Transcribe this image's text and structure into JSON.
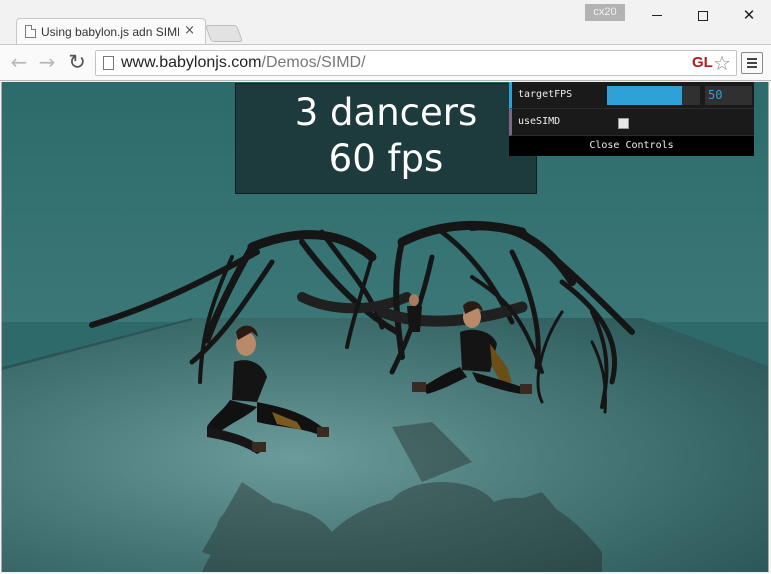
{
  "browser": {
    "tab_title": "Using babylon.js adn SIMD",
    "tab_close": "×",
    "badge": "cx20",
    "window_close": "✕",
    "nav_back": "←",
    "nav_forward": "→",
    "nav_reload": "↻",
    "url_domain": "www.babylonjs.com",
    "url_path": "/Demos/SIMD/",
    "gl_label": "GL",
    "star": "☆"
  },
  "overlay": {
    "dancers_text": "3 dancers",
    "fps_text": "60 fps"
  },
  "controls": {
    "target_fps_label": "targetFPS",
    "target_fps_value": "50",
    "target_fps_fraction": 0.81,
    "use_simd_label": "useSIMD",
    "use_simd_checked": false,
    "close_label": "Close Controls"
  },
  "colors": {
    "slider_accent": "#2fa1d6",
    "background_teal": "#2f6a6b",
    "gl_red": "#b01d1d"
  }
}
